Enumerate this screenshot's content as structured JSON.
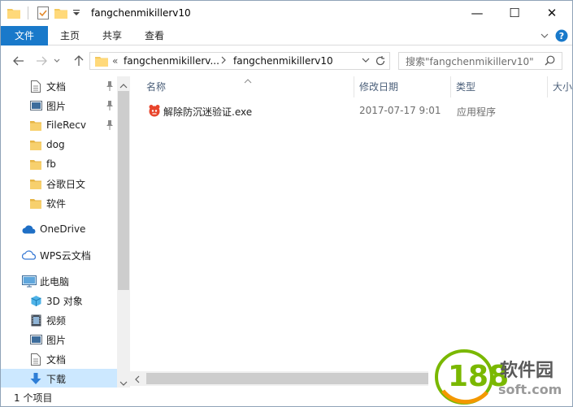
{
  "window": {
    "title": "fangchenmikillerv10",
    "minimize_glyph": "—",
    "maximize_glyph": "☐",
    "close_glyph": "✕"
  },
  "ribbon": {
    "tabs": [
      "文件",
      "主页",
      "共享",
      "查看"
    ]
  },
  "nav": {
    "address_prefix": "«",
    "breadcrumb": [
      "fangchenmikillerv...",
      "fangchenmikillerv10"
    ],
    "search_placeholder": "搜索\"fangchenmikillerv10\""
  },
  "sidebar": {
    "items": [
      {
        "label": "文档",
        "icon": "document-icon",
        "pinned": true
      },
      {
        "label": "图片",
        "icon": "picture-icon",
        "pinned": true
      },
      {
        "label": "FileRecv",
        "icon": "folder-icon",
        "pinned": true
      },
      {
        "label": "dog",
        "icon": "folder-icon",
        "pinned": false
      },
      {
        "label": "fb",
        "icon": "folder-icon",
        "pinned": false
      },
      {
        "label": "谷歌日文",
        "icon": "folder-icon",
        "pinned": false
      },
      {
        "label": "软件",
        "icon": "folder-icon",
        "pinned": false
      },
      {
        "label": "OneDrive",
        "icon": "onedrive-icon",
        "pinned": false
      },
      {
        "label": "WPS云文档",
        "icon": "wps-cloud-icon",
        "pinned": false
      },
      {
        "label": "此电脑",
        "icon": "this-pc-icon",
        "pinned": false
      },
      {
        "label": "3D 对象",
        "icon": "3d-objects-icon",
        "pinned": false
      },
      {
        "label": "视频",
        "icon": "video-icon",
        "pinned": false
      },
      {
        "label": "图片",
        "icon": "picture-icon",
        "pinned": false
      },
      {
        "label": "文档",
        "icon": "document-icon",
        "pinned": false
      },
      {
        "label": "下载",
        "icon": "download-icon",
        "pinned": false
      }
    ]
  },
  "columns": [
    "名称",
    "修改日期",
    "类型",
    "大小"
  ],
  "files": [
    {
      "name": "解除防沉迷验证.exe",
      "modified": "2017-07-17 9:01",
      "type": "应用程序",
      "icon": "exe-app-icon"
    }
  ],
  "status": {
    "count_text": "1 个项目"
  },
  "watermark": {
    "number": "188",
    "brand": "软件园",
    "domain": "soft.com"
  },
  "colors": {
    "accent": "#1979ca",
    "folder": "#f4c95d",
    "selection": "#cce8ff",
    "watermark_green": "#7ab800",
    "watermark_orange": "#f39800"
  }
}
